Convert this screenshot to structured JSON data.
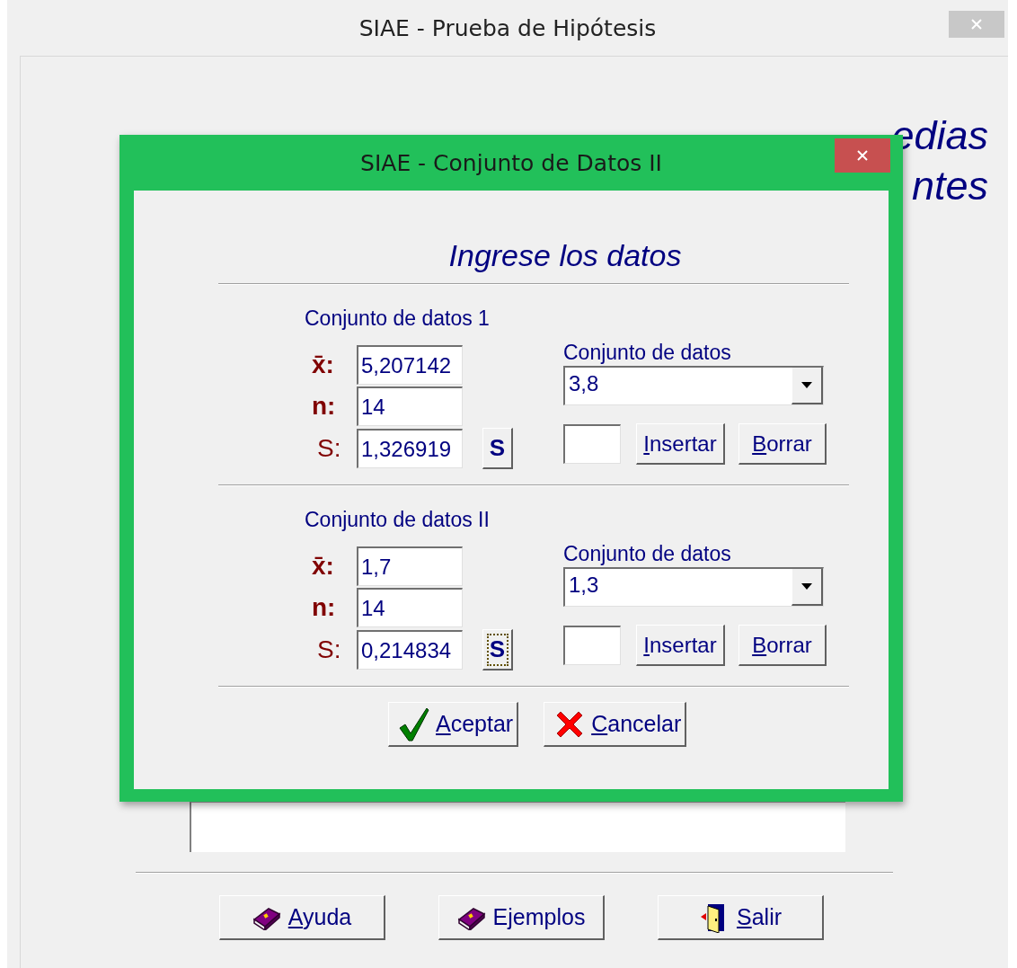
{
  "window": {
    "title": "SIAE - Prueba de Hipótesis"
  },
  "heading": [
    "edias",
    "ntes"
  ],
  "dialog": {
    "title": "SIAE - Conjunto de Datos II",
    "heading": "Ingrese los datos",
    "sets": [
      {
        "title": "Conjunto de datos 1",
        "mean_label": "x̄:",
        "mean": "5,207142",
        "n_label": "n:",
        "n": "14",
        "s_label": "S:",
        "s": "1,326919",
        "s_button": "S",
        "s_button_focused": false,
        "list_label": "Conjunto de datos",
        "list_value": "3,8",
        "insert": "Insertar",
        "delete": "Borrar"
      },
      {
        "title": "Conjunto de datos II",
        "mean_label": "x̄:",
        "mean": "1,7",
        "n_label": "n:",
        "n": "14",
        "s_label": "S:",
        "s": "0,214834",
        "s_button": "S",
        "s_button_focused": true,
        "list_label": "Conjunto de datos",
        "list_value": "1,3",
        "insert": "Insertar",
        "delete": "Borrar"
      }
    ],
    "buttons": [
      {
        "label": "Aceptar"
      },
      {
        "label": "Cancelar"
      }
    ]
  },
  "buttons": [
    {
      "label": "Ayuda",
      "underline_first": true
    },
    {
      "label": "Ejemplos",
      "underline_first": false
    },
    {
      "label": "Salir",
      "underline_first": true
    }
  ]
}
